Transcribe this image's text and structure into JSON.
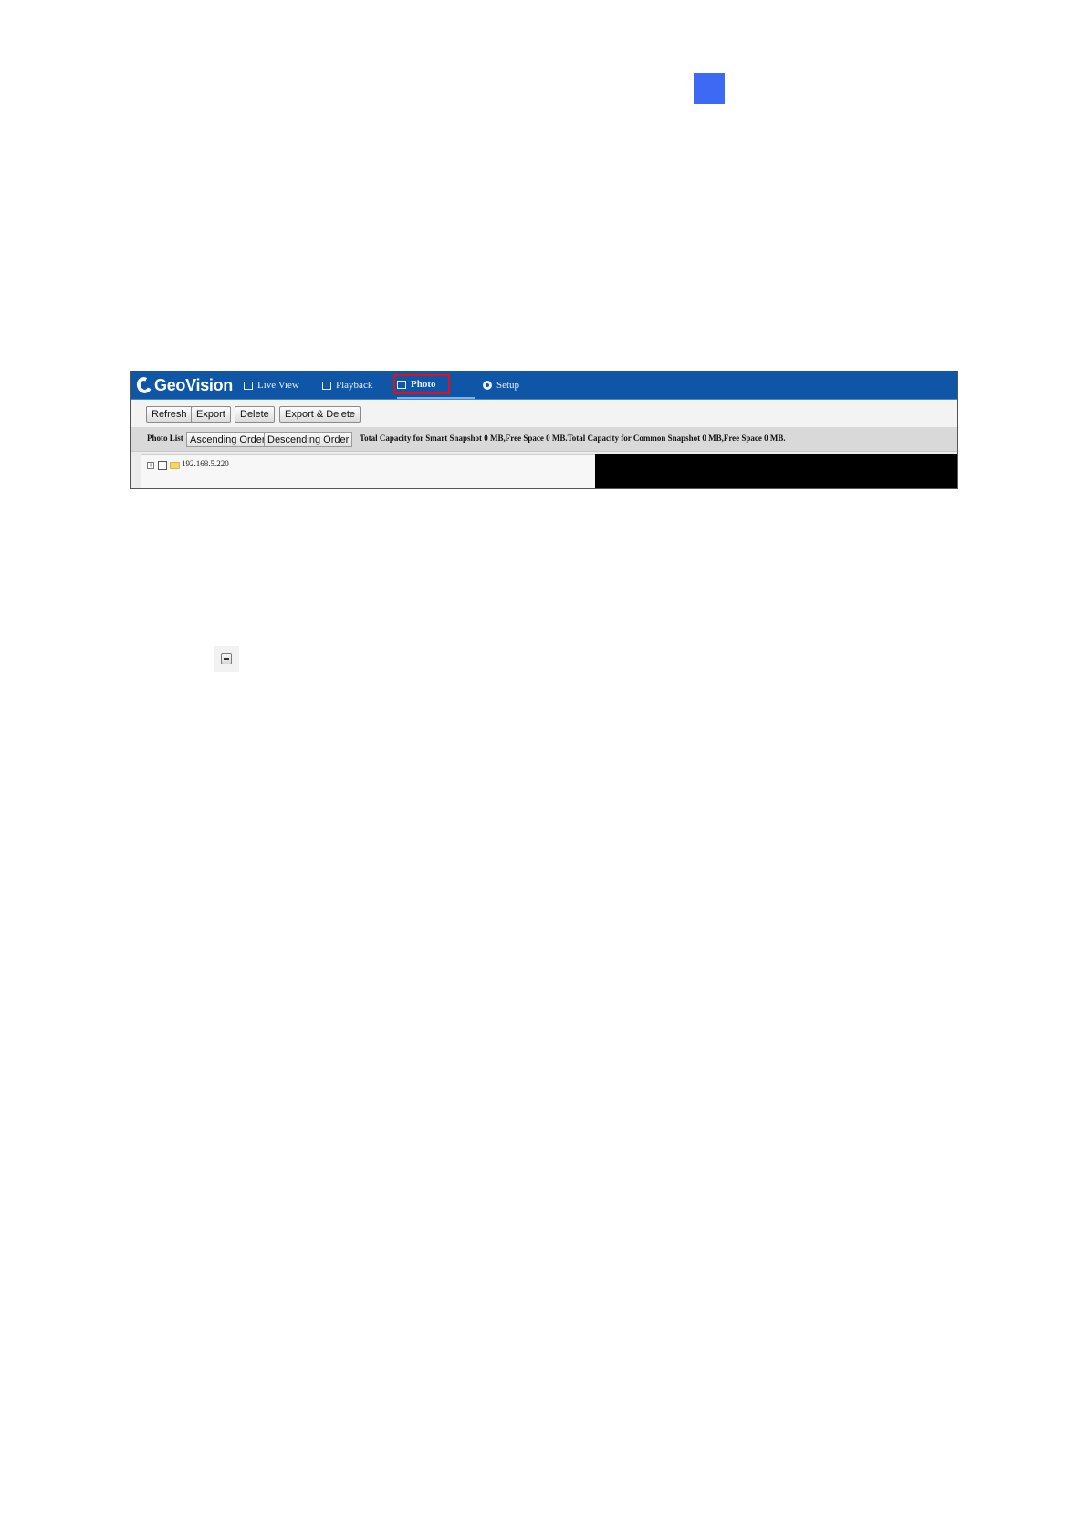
{
  "page": {
    "marker_color": "#3d69f5"
  },
  "app": {
    "logo_text": "GeoVision",
    "nav": {
      "live_view": "Live View",
      "playback": "Playback",
      "photo": "Photo",
      "setup": "Setup"
    },
    "active_tab": "Photo",
    "highlight_color": "#e3101b",
    "nav_color": "#0f56a6"
  },
  "toolbar": {
    "refresh": "Refresh",
    "export": "Export",
    "delete": "Delete",
    "export_delete": "Export & Delete"
  },
  "photo_list": {
    "label": "Photo List",
    "ascending": "Ascending Order",
    "descending": "Descending Order",
    "capacity_text": "Total Capacity for Smart Snapshot 0 MB,Free Space 0 MB.Total Capacity for Common Snapshot 0 MB,Free Space 0 MB."
  },
  "tree": {
    "expander_symbol": "+",
    "node_label": "192.168.5.220"
  },
  "icons": {
    "collapse": "collapse-icon"
  }
}
